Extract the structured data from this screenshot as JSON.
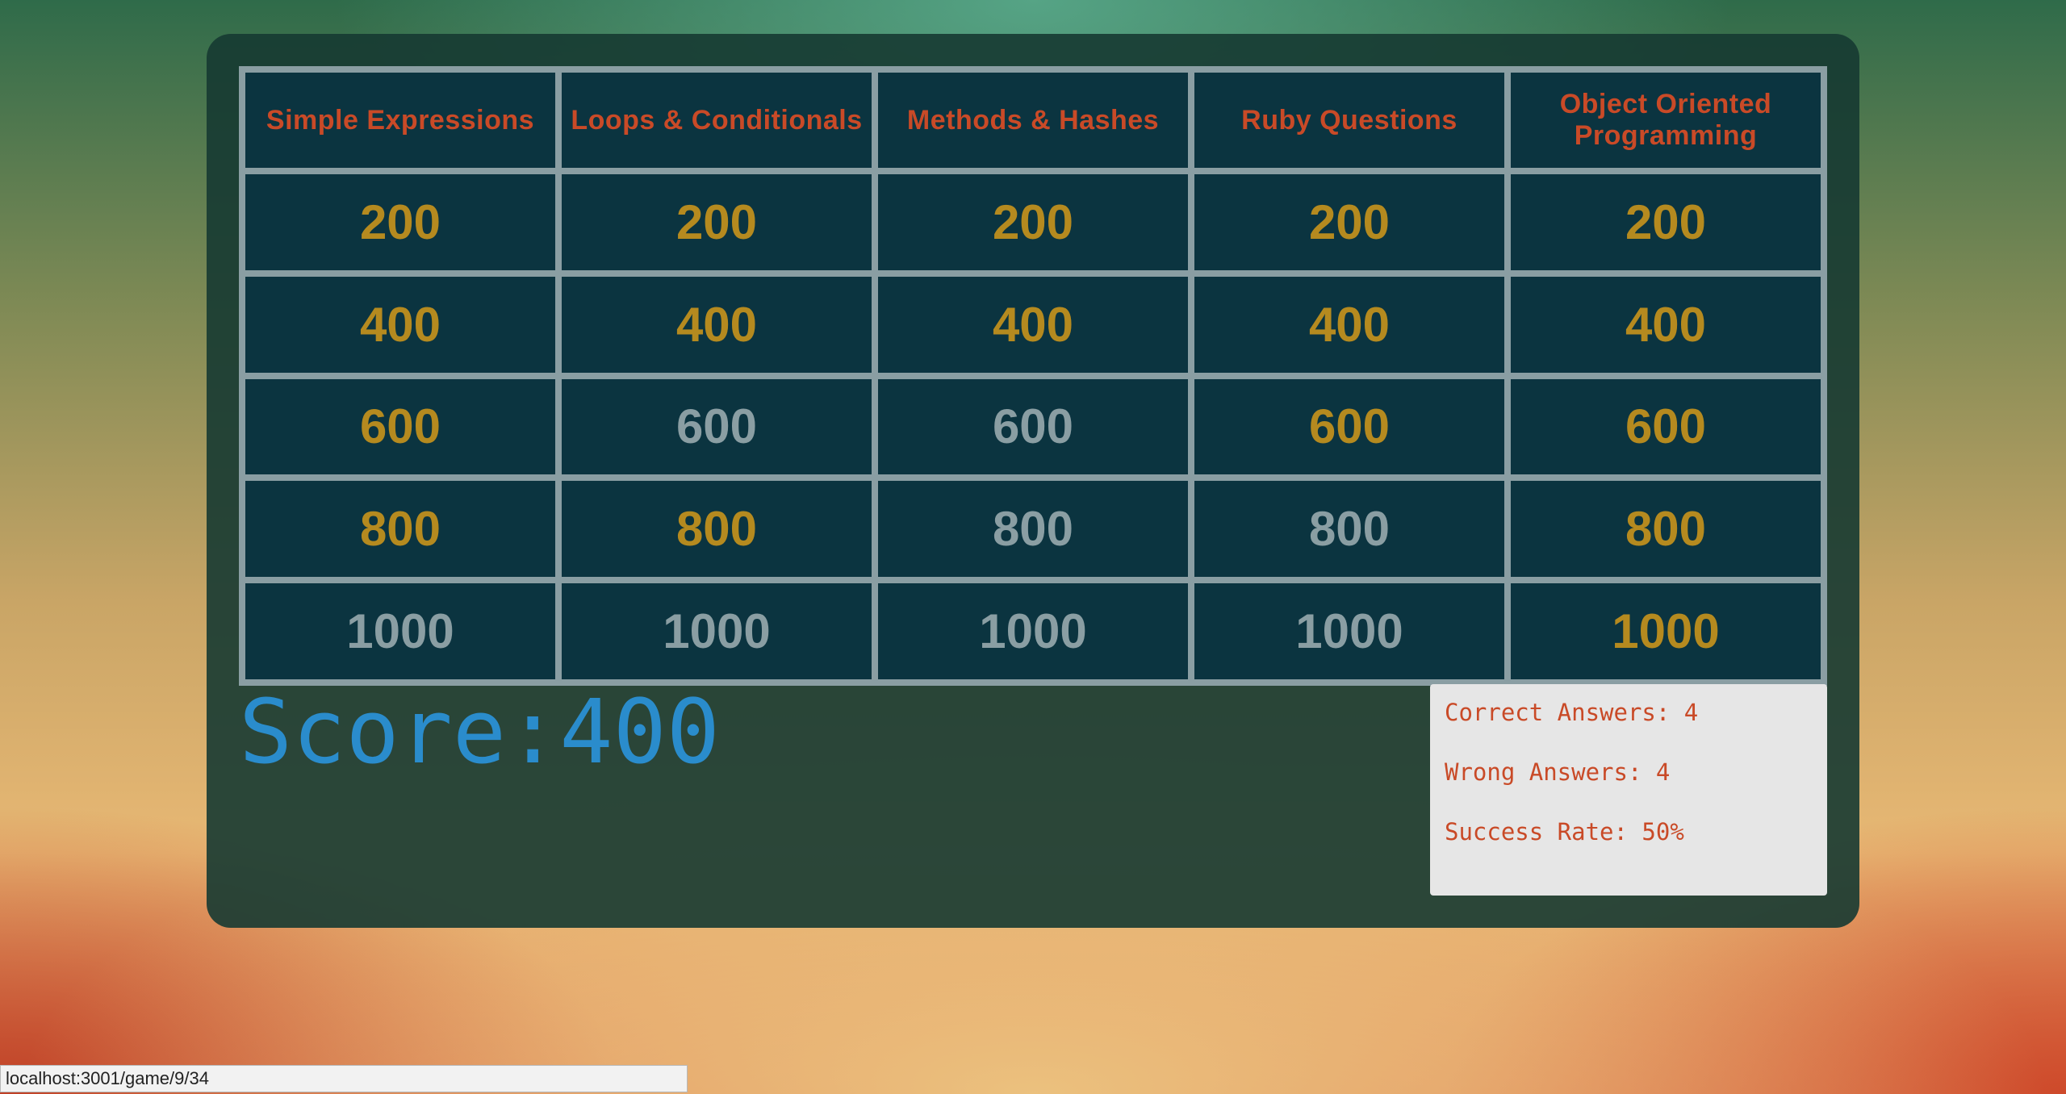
{
  "board": {
    "categories": [
      "Simple Expressions",
      "Loops & Conditionals",
      "Methods & Hashes",
      "Ruby Questions",
      "Object Oriented Programming"
    ],
    "rows": [
      [
        {
          "value": "200",
          "state": "open"
        },
        {
          "value": "200",
          "state": "open"
        },
        {
          "value": "200",
          "state": "open"
        },
        {
          "value": "200",
          "state": "open"
        },
        {
          "value": "200",
          "state": "open"
        }
      ],
      [
        {
          "value": "400",
          "state": "open"
        },
        {
          "value": "400",
          "state": "open"
        },
        {
          "value": "400",
          "state": "open"
        },
        {
          "value": "400",
          "state": "open"
        },
        {
          "value": "400",
          "state": "open"
        }
      ],
      [
        {
          "value": "600",
          "state": "open"
        },
        {
          "value": "600",
          "state": "used"
        },
        {
          "value": "600",
          "state": "used"
        },
        {
          "value": "600",
          "state": "open"
        },
        {
          "value": "600",
          "state": "open"
        }
      ],
      [
        {
          "value": "800",
          "state": "open"
        },
        {
          "value": "800",
          "state": "open"
        },
        {
          "value": "800",
          "state": "used"
        },
        {
          "value": "800",
          "state": "used"
        },
        {
          "value": "800",
          "state": "open"
        }
      ],
      [
        {
          "value": "1000",
          "state": "used"
        },
        {
          "value": "1000",
          "state": "used"
        },
        {
          "value": "1000",
          "state": "used"
        },
        {
          "value": "1000",
          "state": "used"
        },
        {
          "value": "1000",
          "state": "open"
        }
      ]
    ]
  },
  "score": {
    "label": "Score:",
    "value": "400"
  },
  "stats": {
    "correct": "Correct Answers: 4",
    "wrong": "Wrong Answers: 4",
    "success_rate": "Success Rate: 50%"
  },
  "status_bar": {
    "url": "localhost:3001/game/9/34"
  },
  "colors": {
    "category_text": "#c94a27",
    "open_value": "#b58a1f",
    "used_value": "#8a9ea3",
    "cell_bg": "#0b3440",
    "score_text": "#2a8ccc"
  }
}
